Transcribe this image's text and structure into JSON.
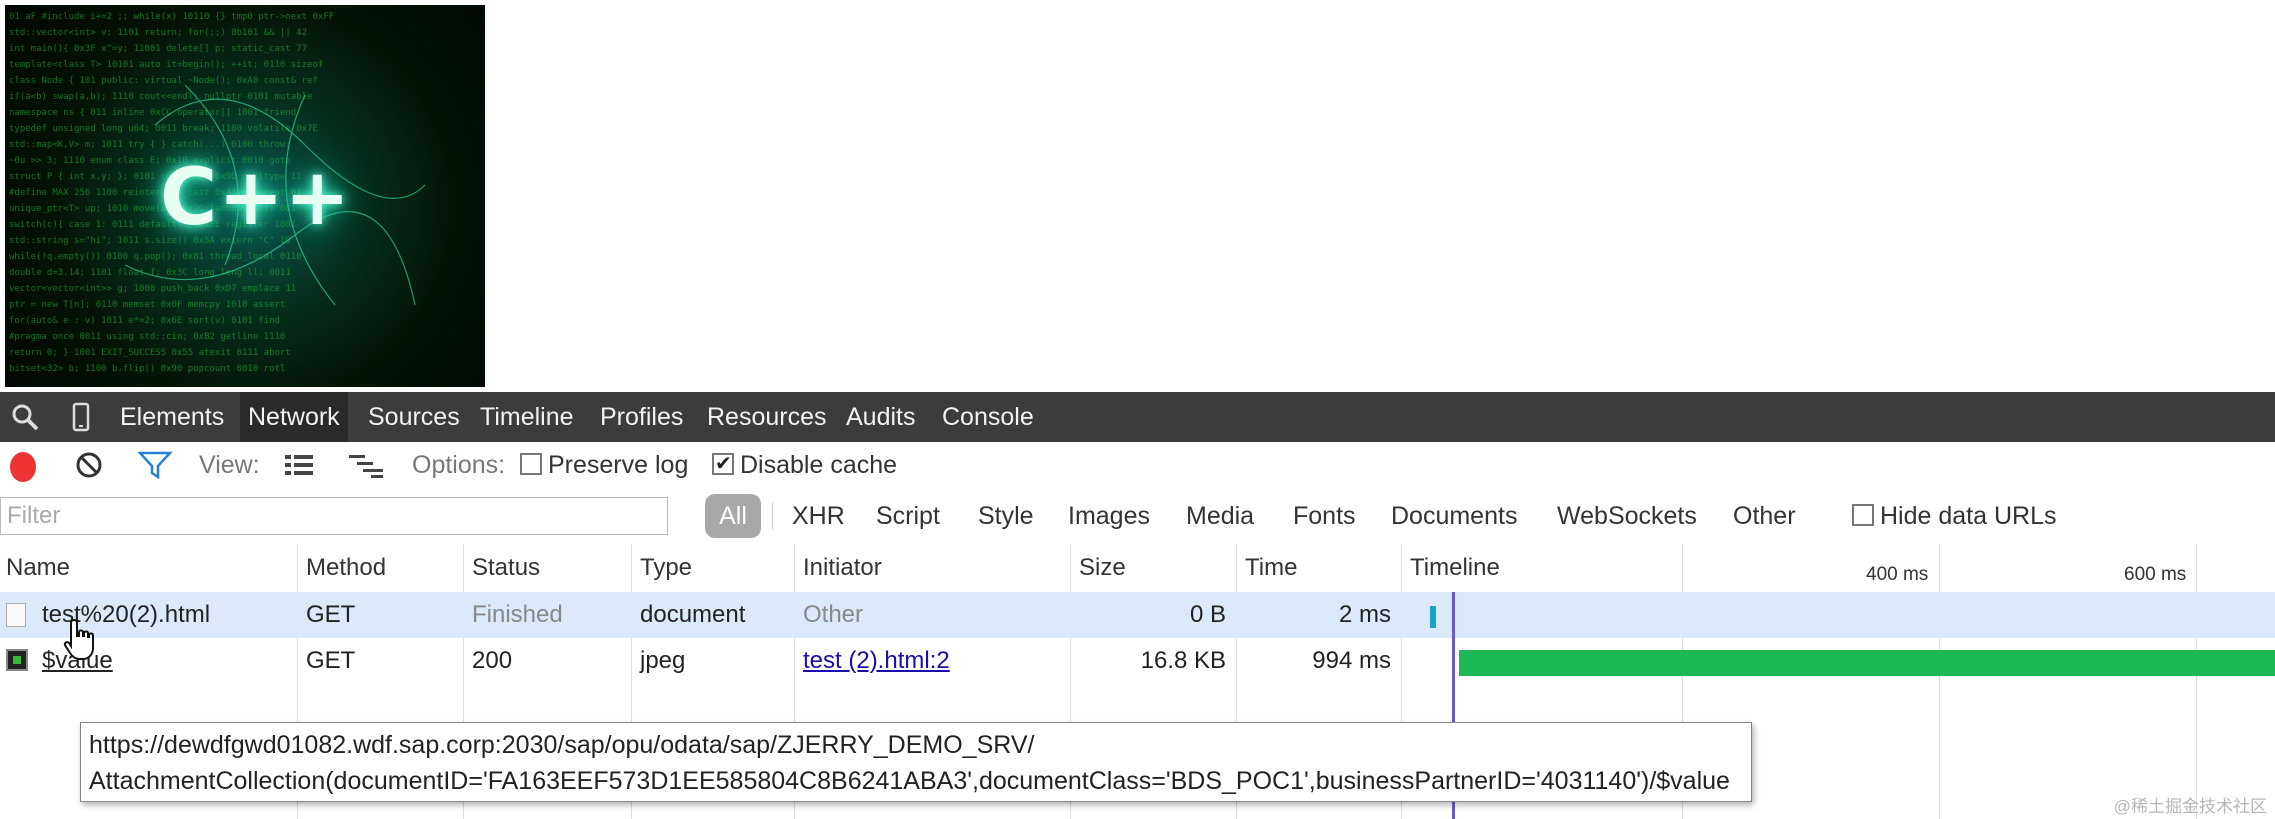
{
  "preview": {
    "logo_text": "C++"
  },
  "tabs": [
    {
      "label": "Elements"
    },
    {
      "label": "Network",
      "active": true
    },
    {
      "label": "Sources"
    },
    {
      "label": "Timeline"
    },
    {
      "label": "Profiles"
    },
    {
      "label": "Resources"
    },
    {
      "label": "Audits"
    },
    {
      "label": "Console"
    }
  ],
  "toolbar": {
    "view_label": "View:",
    "options_label": "Options:",
    "preserve_log": {
      "label": "Preserve log",
      "checked": false
    },
    "disable_cache": {
      "label": "Disable cache",
      "checked": true
    }
  },
  "filter": {
    "placeholder": "Filter",
    "all_label": "All",
    "types": [
      "XHR",
      "Script",
      "Style",
      "Images",
      "Media",
      "Fonts",
      "Documents",
      "WebSockets",
      "Other"
    ],
    "hide_data_urls": {
      "label": "Hide data URLs",
      "checked": false
    }
  },
  "columns": [
    "Name",
    "Method",
    "Status",
    "Type",
    "Initiator",
    "Size",
    "Time",
    "Timeline"
  ],
  "timeline_ticks": [
    "400 ms",
    "600 ms"
  ],
  "rows": [
    {
      "name": "test%20(2).html",
      "method": "GET",
      "status": "Finished",
      "type": "document",
      "initiator": "Other",
      "size": "0 B",
      "time": "2 ms"
    },
    {
      "name": "$value",
      "method": "GET",
      "status": "200",
      "type": "jpeg",
      "initiator": "test (2).html:2",
      "size": "16.8 KB",
      "time": "994 ms"
    }
  ],
  "tooltip": {
    "line1": "https://dewdfgwd01082.wdf.sap.corp:2030/sap/opu/odata/sap/ZJERRY_DEMO_SRV/",
    "line2": "AttachmentCollection(documentID='FA163EEF573D1EE585804C8B6241ABA3',documentClass='BDS_POC1',businessPartnerID='4031140')/$value"
  },
  "watermark": "@稀土掘金技术社区",
  "colors": {
    "record": "#e33333",
    "accent": "#1a0dab",
    "bar_jpeg": "#1db954",
    "bar_doc": "#1aa3c8",
    "marker": "#6a5acd"
  },
  "icons": [
    "search-icon",
    "device-mode-icon",
    "record-icon",
    "clear-icon",
    "filter-icon",
    "list-view-icon",
    "waterfall-view-icon",
    "hand-cursor-icon"
  ]
}
